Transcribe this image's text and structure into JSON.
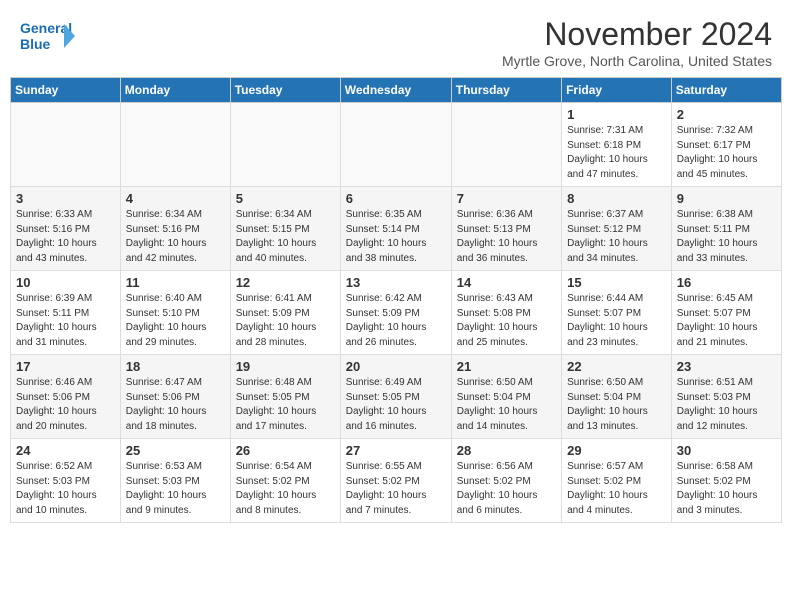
{
  "header": {
    "logo_line1": "General",
    "logo_line2": "Blue",
    "month_year": "November 2024",
    "location": "Myrtle Grove, North Carolina, United States"
  },
  "weekdays": [
    "Sunday",
    "Monday",
    "Tuesday",
    "Wednesday",
    "Thursday",
    "Friday",
    "Saturday"
  ],
  "weeks": [
    [
      {
        "day": "",
        "info": ""
      },
      {
        "day": "",
        "info": ""
      },
      {
        "day": "",
        "info": ""
      },
      {
        "day": "",
        "info": ""
      },
      {
        "day": "",
        "info": ""
      },
      {
        "day": "1",
        "info": "Sunrise: 7:31 AM\nSunset: 6:18 PM\nDaylight: 10 hours and 47 minutes."
      },
      {
        "day": "2",
        "info": "Sunrise: 7:32 AM\nSunset: 6:17 PM\nDaylight: 10 hours and 45 minutes."
      }
    ],
    [
      {
        "day": "3",
        "info": "Sunrise: 6:33 AM\nSunset: 5:16 PM\nDaylight: 10 hours and 43 minutes."
      },
      {
        "day": "4",
        "info": "Sunrise: 6:34 AM\nSunset: 5:16 PM\nDaylight: 10 hours and 42 minutes."
      },
      {
        "day": "5",
        "info": "Sunrise: 6:34 AM\nSunset: 5:15 PM\nDaylight: 10 hours and 40 minutes."
      },
      {
        "day": "6",
        "info": "Sunrise: 6:35 AM\nSunset: 5:14 PM\nDaylight: 10 hours and 38 minutes."
      },
      {
        "day": "7",
        "info": "Sunrise: 6:36 AM\nSunset: 5:13 PM\nDaylight: 10 hours and 36 minutes."
      },
      {
        "day": "8",
        "info": "Sunrise: 6:37 AM\nSunset: 5:12 PM\nDaylight: 10 hours and 34 minutes."
      },
      {
        "day": "9",
        "info": "Sunrise: 6:38 AM\nSunset: 5:11 PM\nDaylight: 10 hours and 33 minutes."
      }
    ],
    [
      {
        "day": "10",
        "info": "Sunrise: 6:39 AM\nSunset: 5:11 PM\nDaylight: 10 hours and 31 minutes."
      },
      {
        "day": "11",
        "info": "Sunrise: 6:40 AM\nSunset: 5:10 PM\nDaylight: 10 hours and 29 minutes."
      },
      {
        "day": "12",
        "info": "Sunrise: 6:41 AM\nSunset: 5:09 PM\nDaylight: 10 hours and 28 minutes."
      },
      {
        "day": "13",
        "info": "Sunrise: 6:42 AM\nSunset: 5:09 PM\nDaylight: 10 hours and 26 minutes."
      },
      {
        "day": "14",
        "info": "Sunrise: 6:43 AM\nSunset: 5:08 PM\nDaylight: 10 hours and 25 minutes."
      },
      {
        "day": "15",
        "info": "Sunrise: 6:44 AM\nSunset: 5:07 PM\nDaylight: 10 hours and 23 minutes."
      },
      {
        "day": "16",
        "info": "Sunrise: 6:45 AM\nSunset: 5:07 PM\nDaylight: 10 hours and 21 minutes."
      }
    ],
    [
      {
        "day": "17",
        "info": "Sunrise: 6:46 AM\nSunset: 5:06 PM\nDaylight: 10 hours and 20 minutes."
      },
      {
        "day": "18",
        "info": "Sunrise: 6:47 AM\nSunset: 5:06 PM\nDaylight: 10 hours and 18 minutes."
      },
      {
        "day": "19",
        "info": "Sunrise: 6:48 AM\nSunset: 5:05 PM\nDaylight: 10 hours and 17 minutes."
      },
      {
        "day": "20",
        "info": "Sunrise: 6:49 AM\nSunset: 5:05 PM\nDaylight: 10 hours and 16 minutes."
      },
      {
        "day": "21",
        "info": "Sunrise: 6:50 AM\nSunset: 5:04 PM\nDaylight: 10 hours and 14 minutes."
      },
      {
        "day": "22",
        "info": "Sunrise: 6:50 AM\nSunset: 5:04 PM\nDaylight: 10 hours and 13 minutes."
      },
      {
        "day": "23",
        "info": "Sunrise: 6:51 AM\nSunset: 5:03 PM\nDaylight: 10 hours and 12 minutes."
      }
    ],
    [
      {
        "day": "24",
        "info": "Sunrise: 6:52 AM\nSunset: 5:03 PM\nDaylight: 10 hours and 10 minutes."
      },
      {
        "day": "25",
        "info": "Sunrise: 6:53 AM\nSunset: 5:03 PM\nDaylight: 10 hours and 9 minutes."
      },
      {
        "day": "26",
        "info": "Sunrise: 6:54 AM\nSunset: 5:02 PM\nDaylight: 10 hours and 8 minutes."
      },
      {
        "day": "27",
        "info": "Sunrise: 6:55 AM\nSunset: 5:02 PM\nDaylight: 10 hours and 7 minutes."
      },
      {
        "day": "28",
        "info": "Sunrise: 6:56 AM\nSunset: 5:02 PM\nDaylight: 10 hours and 6 minutes."
      },
      {
        "day": "29",
        "info": "Sunrise: 6:57 AM\nSunset: 5:02 PM\nDaylight: 10 hours and 4 minutes."
      },
      {
        "day": "30",
        "info": "Sunrise: 6:58 AM\nSunset: 5:02 PM\nDaylight: 10 hours and 3 minutes."
      }
    ]
  ]
}
